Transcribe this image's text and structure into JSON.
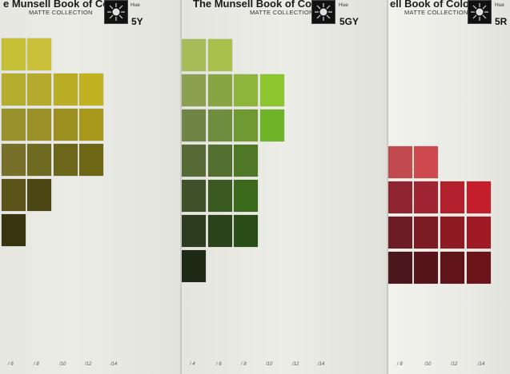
{
  "pages": [
    {
      "title": "e Munsell Book of Color",
      "subtitle": "MATTE COLLECTION",
      "hue_label": "Hue",
      "hue_code": "5Y",
      "chroma_labels": [
        "/ 6",
        "/ 8",
        "/10",
        "/12",
        "/14"
      ],
      "chip_rows": [
        [
          "#c6c037",
          "#cbc039"
        ],
        [
          "#b4ad2f",
          "#b5a92e",
          "#b9ad26",
          "#c0b220"
        ],
        [
          "#99922c",
          "#9a9128",
          "#9b9020",
          "#a7971b"
        ],
        [
          "#77702a",
          "#6f6a21",
          "#6b661a",
          "#6d6715"
        ],
        [
          "#5a541b",
          "#4c4715"
        ],
        [
          "#3a3511"
        ]
      ]
    },
    {
      "title": "The Munsell Book of Color",
      "subtitle": "MATTE COLLECTION",
      "hue_label": "Hue",
      "hue_code": "5GY",
      "chroma_labels": [
        "/ 4",
        "/ 6",
        "/ 8",
        "/10",
        "/12",
        "/14"
      ],
      "chip_rows": [
        [
          "#a8bb57",
          "#a9c04d"
        ],
        [
          "#8aa04f",
          "#88a544",
          "#8db53b",
          "#8dc52c"
        ],
        [
          "#6f8545",
          "#6f8d3e",
          "#6f9a31",
          "#6fb326"
        ],
        [
          "#566a35",
          "#536f30",
          "#4e7825"
        ],
        [
          "#3e5128",
          "#3b5a22",
          "#3b691c"
        ],
        [
          "#2c3c1e",
          "#2b421a",
          "#284d16"
        ],
        [
          "#1f2a16"
        ]
      ]
    },
    {
      "title": "ell Book of Color",
      "subtitle": "MATTE COLLECTION",
      "hue_label": "Hue",
      "hue_code": "5R",
      "chroma_labels": [
        "/ 8",
        "/10",
        "/12",
        "/14"
      ],
      "chip_rows": [
        [
          "#c14a4f",
          "#cf4a4f"
        ],
        [
          "#8f2431",
          "#a02431",
          "#b21f2d",
          "#c51d2c"
        ],
        [
          "#6c1c24",
          "#7c1b23",
          "#8e1a24",
          "#9f1a25"
        ],
        [
          "#4b161c",
          "#55151b",
          "#5f141a",
          "#6b141a"
        ]
      ]
    }
  ]
}
